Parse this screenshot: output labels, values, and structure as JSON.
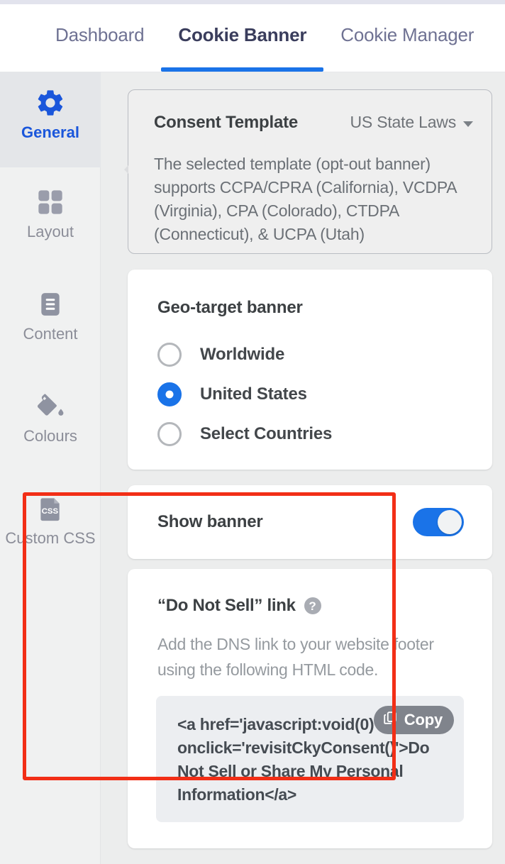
{
  "tabs": [
    {
      "label": "Dashboard",
      "active": false
    },
    {
      "label": "Cookie Banner",
      "active": true
    },
    {
      "label": "Cookie Manager",
      "active": false
    }
  ],
  "sidebar": {
    "items": [
      {
        "label": "General",
        "icon": "gear-icon",
        "active": true
      },
      {
        "label": "Layout",
        "icon": "grid-icon",
        "active": false
      },
      {
        "label": "Content",
        "icon": "document-icon",
        "active": false
      },
      {
        "label": "Colours",
        "icon": "paint-bucket-icon",
        "active": false
      },
      {
        "label": "Custom CSS",
        "icon": "css-file-icon",
        "active": false
      }
    ]
  },
  "consent_template": {
    "title": "Consent Template",
    "selected_value": "US State Laws",
    "dropdown_icon": "chevron-down-icon",
    "description": "The selected template (opt-out banner) supports CCPA/CPRA (California), VCDPA (Virginia), CPA (Colorado), CTDPA (Connecticut), & UCPA (Utah)"
  },
  "geo_target": {
    "title": "Geo-target banner",
    "options": [
      {
        "label": "Worldwide",
        "selected": false
      },
      {
        "label": "United States",
        "selected": true
      },
      {
        "label": "Select Countries",
        "selected": false
      }
    ]
  },
  "show_banner": {
    "title": "Show banner",
    "enabled": true
  },
  "dns_link": {
    "title": "“Do Not Sell” link",
    "help_icon": "help-circle-icon",
    "description": "Add the DNS link to your website footer using the following HTML code.",
    "code": "<a href='javascript:void(0)' onclick='revisitCkyConsent()'>Do Not Sell or Share My Personal Information</a>",
    "copy_label": "Copy",
    "copy_icon": "copy-icon"
  },
  "colors": {
    "accent_blue": "#1a73e8",
    "active_tab_text": "#3a3d5c",
    "tab_text": "#6f7293",
    "sidebar_bg": "#f0f1f1",
    "sidebar_active_bg": "#e4e6e9",
    "sidebar_active_text": "#1a56db",
    "page_bg": "#eceded",
    "card_bg": "#ffffff",
    "highlight_border": "#f22e16",
    "code_bg": "#eceef1",
    "copy_button_bg": "#80848c",
    "muted_text": "#959a9f"
  }
}
